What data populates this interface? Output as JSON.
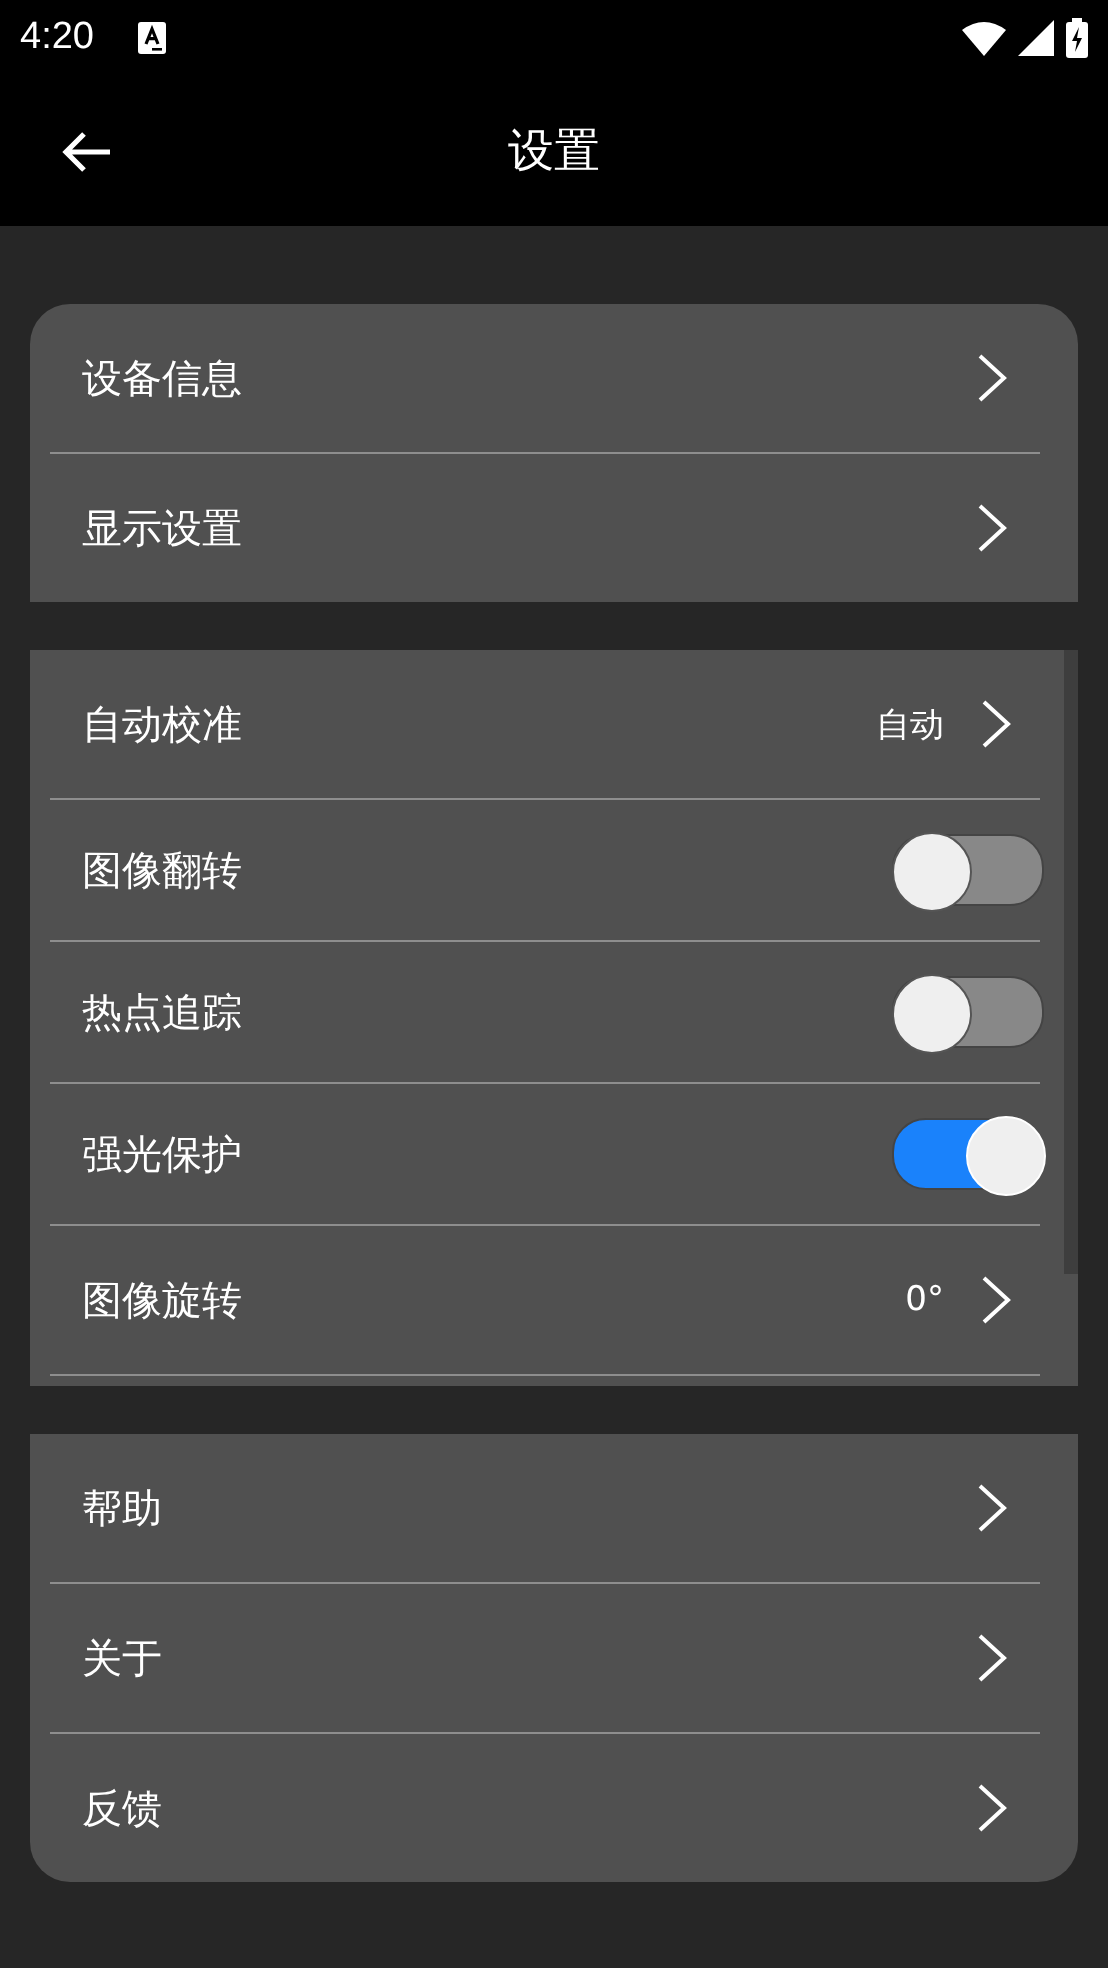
{
  "status_bar": {
    "time": "4:20"
  },
  "header": {
    "title": "设置"
  },
  "sections": [
    {
      "items": [
        {
          "kind": "link",
          "label": "设备信息"
        },
        {
          "kind": "link",
          "label": "显示设置"
        }
      ]
    },
    {
      "items": [
        {
          "kind": "value",
          "label": "自动校准",
          "value": "自动"
        },
        {
          "kind": "toggle",
          "label": "图像翻转",
          "on": false
        },
        {
          "kind": "toggle",
          "label": "热点追踪",
          "on": false
        },
        {
          "kind": "toggle",
          "label": "强光保护",
          "on": true
        },
        {
          "kind": "value",
          "label": "图像旋转",
          "value": "0°"
        }
      ]
    },
    {
      "items": [
        {
          "kind": "link",
          "label": "帮助"
        },
        {
          "kind": "link",
          "label": "关于"
        },
        {
          "kind": "link",
          "label": "反馈"
        }
      ]
    }
  ]
}
